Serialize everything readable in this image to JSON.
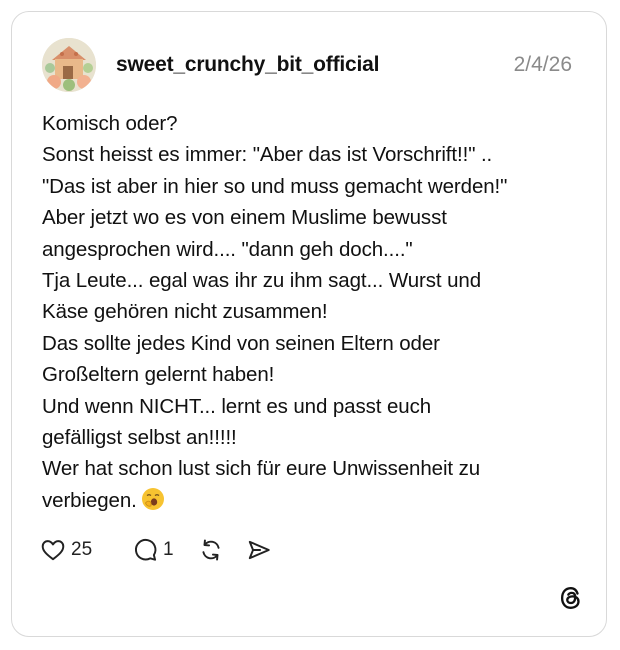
{
  "post": {
    "username": "sweet_crunchy_bit_official",
    "date": "2/4/26",
    "lines": [
      "Komisch oder?",
      "Sonst heisst es immer: \"Aber das ist Vorschrift!!\" ..",
      "\"Das ist aber in hier so und muss gemacht werden!\"",
      "Aber jetzt wo es von einem Muslime bewusst",
      "angesprochen wird.... \"dann geh doch....\"",
      "Tja Leute... egal was ihr zu ihm sagt... Wurst und",
      "Käse gehören nicht zusammen!",
      "Das sollte jedes Kind von seinen Eltern oder",
      "Großeltern gelernt haben!",
      "Und wenn NICHT... lernt es und passt euch",
      "gefälligst selbst an!!!!!",
      "Wer hat schon lust sich für eure Unwissenheit zu",
      "verbiegen."
    ],
    "trailing_emoji": "yawning-face-emoji"
  },
  "actions": {
    "likes": "25",
    "replies": "1",
    "like_icon": "heart-icon",
    "reply_icon": "comment-icon",
    "repost_icon": "repost-icon",
    "share_icon": "share-send-icon"
  },
  "brand": {
    "logo": "threads-logo-icon"
  },
  "colors": {
    "text": "#111111",
    "date": "#8a8a8a",
    "border": "#d9d9d9",
    "emoji": "#f7c331"
  }
}
